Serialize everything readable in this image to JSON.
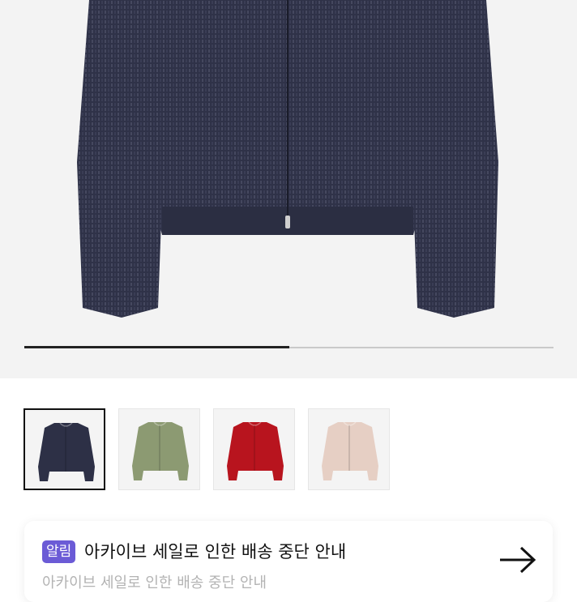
{
  "product": {
    "main_image": "navy-zip-cardigan-photo",
    "image_progress": 0.5,
    "colors": {
      "background": "#f3f3f3",
      "progress_fill": "#222222",
      "progress_track": "#c9c9c9"
    }
  },
  "thumbnails": [
    {
      "name": "navy",
      "color": "#2d3046",
      "selected": true
    },
    {
      "name": "sage",
      "color": "#8c9a72",
      "selected": false
    },
    {
      "name": "red",
      "color": "#b8141e",
      "selected": false
    },
    {
      "name": "beige",
      "color": "#e6cfc4",
      "selected": false
    }
  ],
  "notice": {
    "badge": "알림",
    "badge_color": "#6b5bd6",
    "title": "아카이브 세일로 인한 배송 중단 안내",
    "subtitle": "아카이브 세일로 인한 배송 중단 안내",
    "arrow_icon": "arrow-right-icon"
  }
}
